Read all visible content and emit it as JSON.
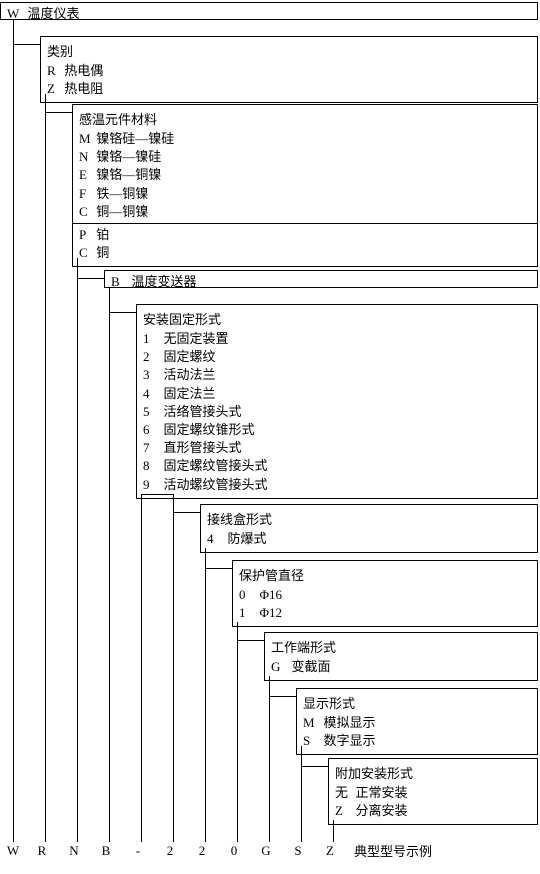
{
  "chart_data": {
    "type": "diagram",
    "title": "典型型号示例",
    "positions": [
      {
        "code": "W",
        "heading": "温度仪表",
        "items": []
      },
      {
        "heading": "类别",
        "items": [
          {
            "code": "R",
            "label": "热电偶"
          },
          {
            "code": "Z",
            "label": "热电阻"
          }
        ]
      },
      {
        "heading": "感温元件材料",
        "groups": [
          {
            "items": [
              {
                "code": "M",
                "label": "镍铬硅—镍硅"
              },
              {
                "code": "N",
                "label": "镍铬—镍硅"
              },
              {
                "code": "E",
                "label": "镍铬—铜镍"
              },
              {
                "code": "F",
                "label": "铁—铜镍"
              },
              {
                "code": "C",
                "label": "铜—铜镍"
              }
            ]
          },
          {
            "items": [
              {
                "code": "P",
                "label": "铂"
              },
              {
                "code": "C",
                "label": "铜"
              }
            ]
          }
        ]
      },
      {
        "code": "B",
        "heading": "温度变送器",
        "items": []
      },
      {
        "heading": "安装固定形式",
        "items": [
          {
            "code": "1",
            "label": "无固定装置"
          },
          {
            "code": "2",
            "label": "固定螺纹"
          },
          {
            "code": "3",
            "label": "活动法兰"
          },
          {
            "code": "4",
            "label": "固定法兰"
          },
          {
            "code": "5",
            "label": "活络管接头式"
          },
          {
            "code": "6",
            "label": "固定螺纹锥形式"
          },
          {
            "code": "7",
            "label": "直形管接头式"
          },
          {
            "code": "8",
            "label": "固定螺纹管接头式"
          },
          {
            "code": "9",
            "label": "活动螺纹管接头式"
          }
        ]
      },
      {
        "heading": "接线盒形式",
        "items": [
          {
            "code": "4",
            "label": "防爆式"
          }
        ]
      },
      {
        "heading": "保护管直径",
        "items": [
          {
            "code": "0",
            "label": "Φ16"
          },
          {
            "code": "1",
            "label": "Φ12"
          }
        ]
      },
      {
        "heading": "工作端形式",
        "items": [
          {
            "code": "G",
            "label": "变截面"
          }
        ]
      },
      {
        "heading": "显示形式",
        "items": [
          {
            "code": "M",
            "label": "模拟显示"
          },
          {
            "code": "S",
            "label": "数字显示"
          }
        ]
      },
      {
        "heading": "附加安装形式",
        "items": [
          {
            "code": "无",
            "label": "正常安装"
          },
          {
            "code": "Z",
            "label": "分离安装"
          }
        ]
      }
    ],
    "example": [
      "W",
      "R",
      "N",
      "B",
      "-",
      "2",
      "2",
      "0",
      "G",
      "S",
      "Z"
    ],
    "example_label": "典型型号示例"
  }
}
